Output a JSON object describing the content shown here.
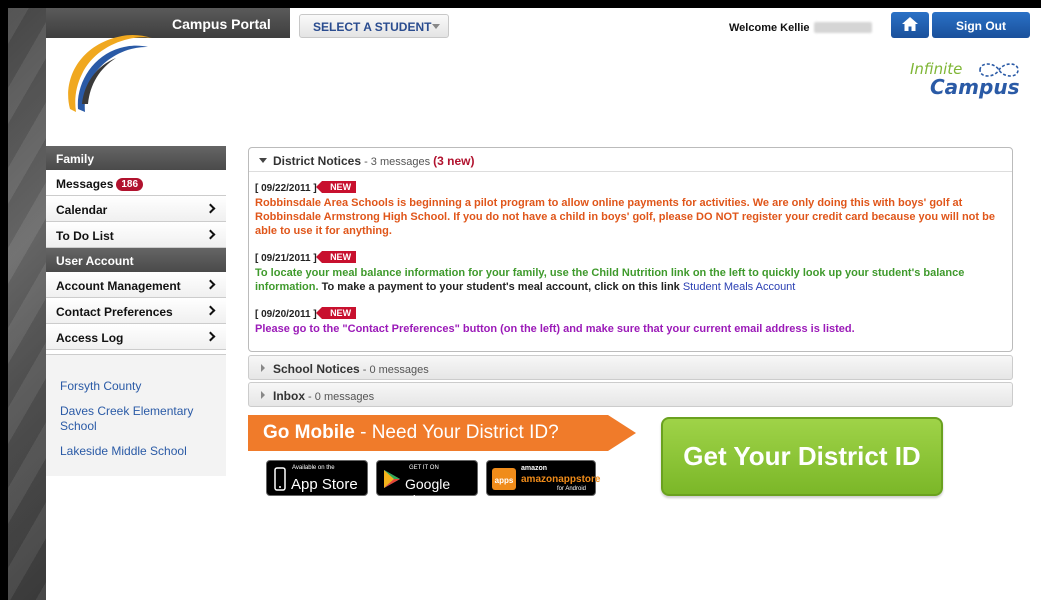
{
  "header": {
    "portal_title": "Campus Portal",
    "select_student": "SELECT A STUDENT",
    "welcome": "Welcome Kellie",
    "sign_out": "Sign Out",
    "logo_line1": "Infinite",
    "logo_line2": "Campus"
  },
  "sidebar": {
    "family_heading": "Family",
    "items_family": [
      {
        "label": "Messages",
        "badge": "186"
      },
      {
        "label": "Calendar"
      },
      {
        "label": "To Do List"
      }
    ],
    "account_heading": "User Account",
    "items_account": [
      {
        "label": "Account Management"
      },
      {
        "label": "Contact Preferences"
      },
      {
        "label": "Access Log"
      }
    ],
    "schools": [
      "Forsyth County",
      "Daves Creek Elementary School",
      "Lakeside Middle School"
    ]
  },
  "district_notices": {
    "title": "District Notices",
    "count": " - 3 messages ",
    "new_count": "(3 new)",
    "new_tag": "NEW",
    "messages": [
      {
        "date": "[ 09/22/2011 ]",
        "text": "Robbinsdale Area Schools is beginning a pilot program to allow online payments for activities.  We are only doing this with boys' golf at Robbinsdale Armstrong High School.  If you do not have a child in boys' golf, please DO NOT register your credit card because you will not be able to use it for anything."
      },
      {
        "date": "[ 09/21/2011 ]",
        "text": "To locate your meal balance information for your family, use the Child Nutrition link on the left to quickly look up your student's balance information.",
        "text_plain": " To make a payment to your student's meal account, click on this link ",
        "link": "Student Meals Account"
      },
      {
        "date": "[ 09/20/2011 ]",
        "text": "Please go to the \"Contact Preferences\" button (on the left) and make sure that your current email address is listed."
      }
    ]
  },
  "school_notices": {
    "title": "School Notices",
    "count": " - 0 messages"
  },
  "inbox": {
    "title": "Inbox",
    "count": " - 0 messages"
  },
  "promo": {
    "go_mobile": "Go Mobile",
    "need_id": " - Need Your District ID?",
    "app_store_small": "Available on the",
    "app_store": "App Store",
    "google_small": "GET IT ON",
    "google": "Google play",
    "amazon_small": "amazon",
    "amazon": "amazonappstore",
    "amazon_sub": "for Android",
    "district_button": "Get Your District ID"
  },
  "colors": {
    "accent_blue": "#1a509b",
    "alert_red": "#c8102e",
    "orange": "#f07b2a",
    "green": "#7bb728"
  }
}
